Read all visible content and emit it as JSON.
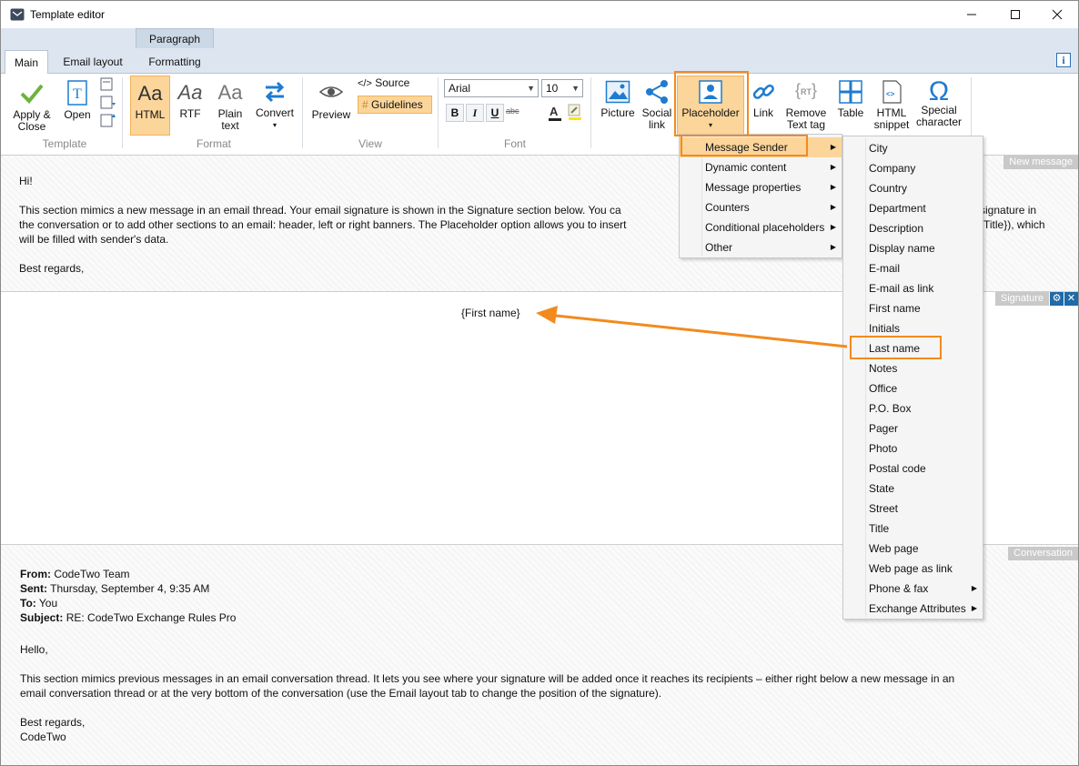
{
  "window": {
    "title": "Template editor"
  },
  "ribbon": {
    "context_tab": "Paragraph",
    "tabs": [
      "Main",
      "Email layout",
      "Formatting"
    ],
    "info_label": "i",
    "groups": {
      "template": {
        "label": "Template",
        "apply": "Apply &",
        "apply2": "Close",
        "open": "Open"
      },
      "format": {
        "label": "Format",
        "html": "HTML",
        "rtf": "RTF",
        "plain": "Plain",
        "plain2": "text",
        "convert": "Convert"
      },
      "view": {
        "label": "View",
        "preview": "Preview",
        "source": "Source",
        "guidelines": "Guidelines"
      },
      "font": {
        "label": "Font",
        "font_name": "Arial",
        "font_size": "10",
        "bold": "B",
        "italic": "I",
        "underline": "U",
        "strike": "abc"
      },
      "insert": {
        "picture": "Picture",
        "social": "Social",
        "social2": "link",
        "placeholder": "Placeholder",
        "link": "Link",
        "remove": "Remove",
        "remove2": "Text tag",
        "table": "Table",
        "snippet": "HTML",
        "snippet2": "snippet",
        "special": "Special",
        "special2": "character"
      }
    }
  },
  "panes": {
    "new_message": {
      "label": "New message",
      "greeting": "Hi!",
      "body_line1": "This section mimics a new message in an email thread. Your email signature is shown in the Signature section below. You ca",
      "body_line1_end": "signature in",
      "body_line2": "the conversation or to add other sections to an email: header, left or right banners. The Placeholder option allows you to insert",
      "body_line2_end": "Title}), which",
      "body_line3": "will be filled with sender's data.",
      "closing": "Best regards,"
    },
    "signature": {
      "label": "Signature",
      "placeholder_text": "{First name}"
    },
    "conversation": {
      "label": "Conversation",
      "from_label": "From:",
      "from_value": "CodeTwo Team",
      "sent_label": "Sent:",
      "sent_value": "Thursday, September 4, 9:35 AM",
      "to_label": "To:",
      "to_value": "You",
      "subject_label": "Subject:",
      "subject_value": "RE: CodeTwo Exchange Rules Pro",
      "hello": "Hello,",
      "body_line1": "This section mimics previous messages in an email conversation thread. It lets you see where your signature will be added once it reaches its recipients – either right below a new message in an",
      "body_line2": "email conversation thread or at the very bottom of the conversation (use the Email layout tab to change the position of the signature).",
      "closing1": "Best regards,",
      "closing2": "CodeTwo"
    }
  },
  "placeholder_menu": {
    "items": [
      "Message Sender",
      "Dynamic content",
      "Message properties",
      "Counters",
      "Conditional placeholders",
      "Other"
    ],
    "selected": "Message Sender"
  },
  "sender_submenu": {
    "items": [
      "City",
      "Company",
      "Country",
      "Department",
      "Description",
      "Display name",
      "E-mail",
      "E-mail as link",
      "First name",
      "Initials",
      "Last name",
      "Notes",
      "Office",
      "P.O. Box",
      "Pager",
      "Photo",
      "Postal code",
      "State",
      "Street",
      "Title",
      "Web page",
      "Web page as link",
      "Phone & fax",
      "Exchange Attributes"
    ],
    "highlighted": "Last name"
  },
  "colors": {
    "accent": "#f28a1e",
    "brand_blue": "#1f7bd0",
    "selected_bg": "#fbd59a"
  }
}
